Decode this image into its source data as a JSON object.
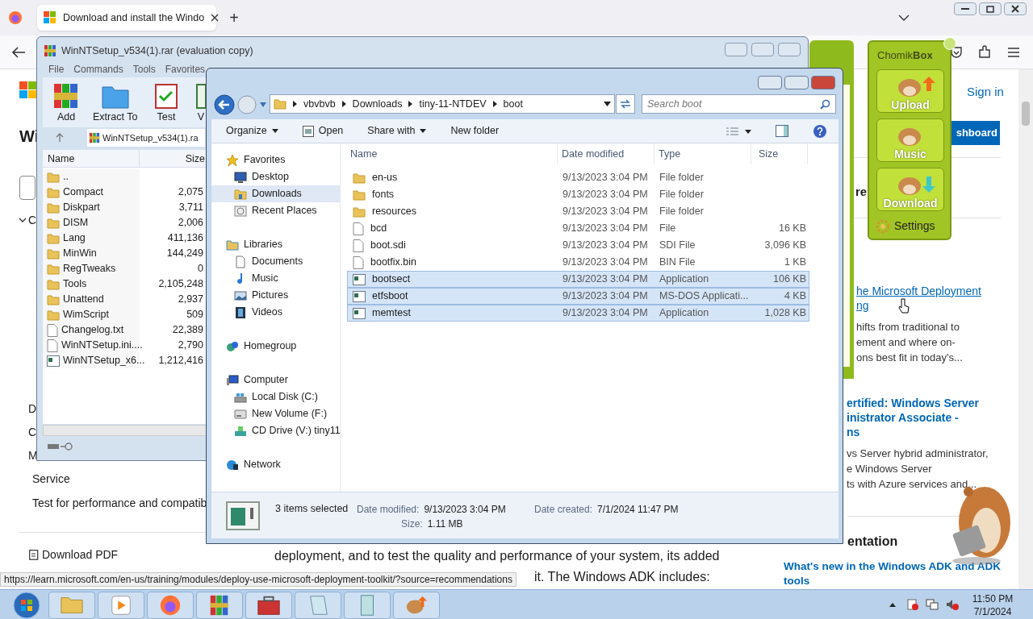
{
  "browser": {
    "tab": {
      "title": "Download and install the Windo",
      "selected": true
    },
    "new_tab": "+",
    "sign_in": "Sign in",
    "dashboard_button": "shboard",
    "page": {
      "heading": "Wi",
      "left_fragments": [
        "C",
        "D",
        "C",
        "M"
      ],
      "service_label": "Service",
      "service_text": "Test for performance and compatib",
      "download_pdf": "Download PDF",
      "side_fragment": "re",
      "links": [
        {
          "title_lines": [
            "he Microsoft Deployment",
            "ng"
          ],
          "desc_lines": [
            "hifts from traditional to",
            "ement and where on-",
            "ons best fit in today's..."
          ]
        },
        {
          "title_lines": [
            "ertified: Windows Server",
            "inistrator Associate -",
            "ns"
          ],
          "desc_lines": [
            "vs Server hybrid administrator,",
            "e Windows Server",
            "ts with Azure services and..."
          ]
        }
      ],
      "documentation_heading": "entation",
      "adk_link": [
        "What's new in the Windows ADK and ADK",
        "tools"
      ],
      "body_lines": [
        "deployment, and to test the quality and performance of your system, its added",
        "it. The Windows ADK includes:"
      ]
    },
    "status_url": "https://learn.microsoft.com/en-us/training/modules/deploy-use-microsoft-deployment-toolkit/?source=recommendations"
  },
  "winrar": {
    "title": "WinNTSetup_v534(1).rar (evaluation copy)",
    "menu": [
      "File",
      "Commands",
      "Tools",
      "Favorites"
    ],
    "tools": [
      "Add",
      "Extract To",
      "Test",
      "V"
    ],
    "path": "WinNTSetup_v534(1).ra",
    "columns": [
      "Name",
      "Size"
    ],
    "rows": [
      {
        "name": "..",
        "kind": "folder"
      },
      {
        "name": "Compact",
        "size": "2,075",
        "kind": "folder"
      },
      {
        "name": "Diskpart",
        "size": "3,711",
        "kind": "folder"
      },
      {
        "name": "DISM",
        "size": "2,006",
        "kind": "folder"
      },
      {
        "name": "Lang",
        "size": "411,136",
        "kind": "folder"
      },
      {
        "name": "MinWin",
        "size": "144,249",
        "kind": "folder"
      },
      {
        "name": "RegTweaks",
        "size": "0",
        "kind": "folder"
      },
      {
        "name": "Tools",
        "size": "2,105,248",
        "kind": "folder"
      },
      {
        "name": "Unattend",
        "size": "2,937",
        "kind": "folder"
      },
      {
        "name": "WimScript",
        "size": "509",
        "kind": "folder"
      },
      {
        "name": "Changelog.txt",
        "size": "22,389",
        "kind": "file"
      },
      {
        "name": "WinNTSetup.ini....",
        "size": "2,790",
        "kind": "file"
      },
      {
        "name": "WinNTSetup_x6...",
        "size": "1,212,416",
        "kind": "app"
      }
    ]
  },
  "explorer": {
    "breadcrumbs": [
      "vbvbvb",
      "Downloads",
      "tiny-11-NTDEV",
      "boot"
    ],
    "search": {
      "placeholder": "Search boot"
    },
    "toolbar": [
      {
        "label": "Organize",
        "kind": "menu"
      },
      {
        "label": "Open",
        "kind": "open"
      },
      {
        "label": "Share with",
        "kind": "menu"
      },
      {
        "label": "New folder",
        "kind": "plain"
      }
    ],
    "nav": [
      {
        "label": "Favorites",
        "children": [
          {
            "label": "Desktop",
            "selected": false
          },
          {
            "label": "Downloads",
            "selected": true
          },
          {
            "label": "Recent Places",
            "selected": false
          }
        ]
      },
      {
        "label": "Libraries",
        "children": [
          {
            "label": "Documents",
            "selected": false
          },
          {
            "label": "Music",
            "selected": false
          },
          {
            "label": "Pictures",
            "selected": false
          },
          {
            "label": "Videos",
            "selected": false
          }
        ]
      },
      {
        "label": "Homegroup"
      },
      {
        "label": "Computer",
        "children": [
          {
            "label": "Local Disk (C:)",
            "selected": false
          },
          {
            "label": "New Volume (F:)",
            "selected": false
          },
          {
            "label": "CD Drive (V:) tiny11",
            "selected": false
          }
        ]
      },
      {
        "label": "Network"
      }
    ],
    "columns": [
      "Name",
      "Date modified",
      "Type",
      "Size"
    ],
    "files": [
      {
        "name": "en-us",
        "modified": "9/13/2023 3:04 PM",
        "type": "File folder",
        "kind": "folder",
        "selected": false
      },
      {
        "name": "fonts",
        "modified": "9/13/2023 3:04 PM",
        "type": "File folder",
        "kind": "folder",
        "selected": false
      },
      {
        "name": "resources",
        "modified": "9/13/2023 3:04 PM",
        "type": "File folder",
        "kind": "folder",
        "selected": false
      },
      {
        "name": "bcd",
        "modified": "9/13/2023 3:04 PM",
        "type": "File",
        "size": "16 KB",
        "kind": "file",
        "selected": false
      },
      {
        "name": "boot.sdi",
        "modified": "9/13/2023 3:04 PM",
        "type": "SDI File",
        "size": "3,096 KB",
        "kind": "file",
        "selected": false
      },
      {
        "name": "bootfix.bin",
        "modified": "9/13/2023 3:04 PM",
        "type": "BIN File",
        "size": "1 KB",
        "kind": "file",
        "selected": false
      },
      {
        "name": "bootsect",
        "modified": "9/13/2023 3:04 PM",
        "type": "Application",
        "size": "106 KB",
        "kind": "app",
        "selected": true
      },
      {
        "name": "etfsboot",
        "modified": "9/13/2023 3:04 PM",
        "type": "MS-DOS Applicati...",
        "size": "4 KB",
        "kind": "app",
        "selected": true
      },
      {
        "name": "memtest",
        "modified": "9/13/2023 3:04 PM",
        "type": "Application",
        "size": "1,028 KB",
        "kind": "app",
        "selected": true
      }
    ],
    "status": {
      "selection": "3 items selected",
      "modified_label": "Date modified:",
      "modified": "9/13/2023 3:04 PM",
      "created_label": "Date created:",
      "created": "7/1/2024 11:47 PM",
      "size_label": "Size:",
      "size": "1.11 MB"
    }
  },
  "chomikbox": {
    "title_plain": "Chomik",
    "title_bold": "Box",
    "buttons": [
      "Upload",
      "Music",
      "Download"
    ],
    "settings": "Settings"
  },
  "taskbar": {
    "time": "11:50 PM",
    "date": "7/1/2024"
  }
}
